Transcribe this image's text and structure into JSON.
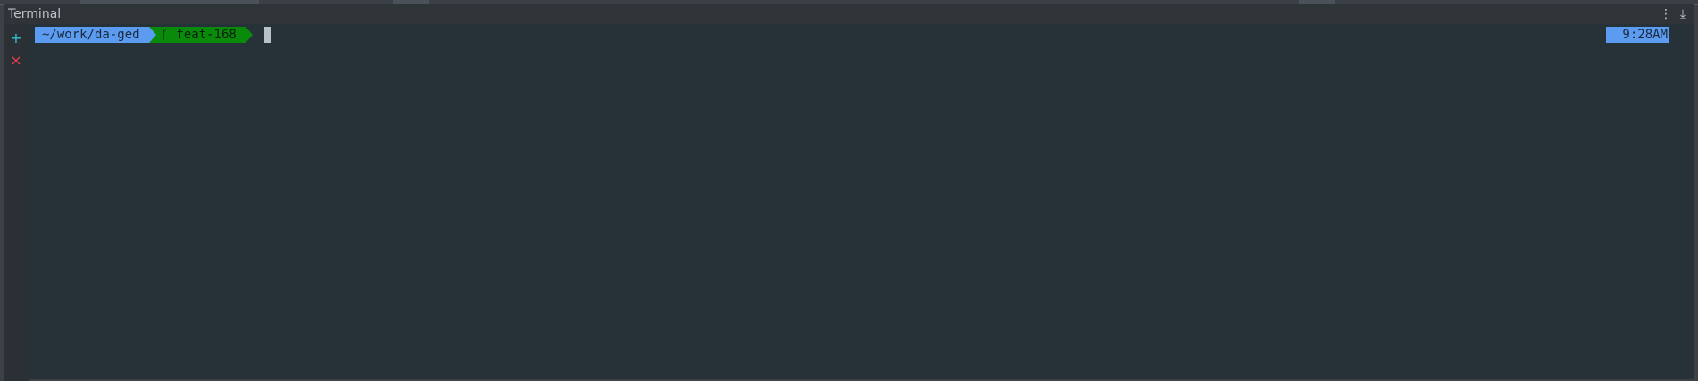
{
  "panel": {
    "title": "Terminal",
    "menu_glyph": "⋮",
    "minimize_glyph": "⤓"
  },
  "gutter": {
    "add_glyph": "+",
    "close_glyph": "×"
  },
  "prompt": {
    "directory": "~/work/da-ged",
    "branch": " feat-168",
    "time": "9:28AM"
  },
  "icons": [
    "more-icon",
    "minimize-icon",
    "plus-icon",
    "close-icon",
    "branch-icon"
  ],
  "colors": {
    "dir_segment": "#5b9bf0",
    "git_segment": "#0a8a0a",
    "terminal_bg": "#263238",
    "add_icon": "#35c0d6",
    "close_icon": "#e04050"
  }
}
